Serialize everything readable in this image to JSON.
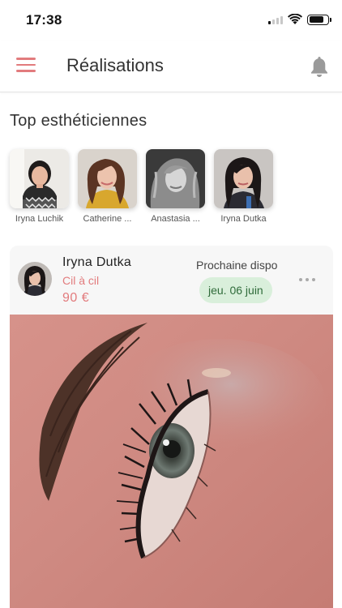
{
  "status_bar": {
    "time": "17:38"
  },
  "header": {
    "title": "Réalisations"
  },
  "top_section": {
    "title": "Top esthéticiennes",
    "estheticians": [
      {
        "name": "Iryna Luchik"
      },
      {
        "name": "Catherine ..."
      },
      {
        "name": "Anastasia ..."
      },
      {
        "name": "Iryna Dutka"
      }
    ]
  },
  "post": {
    "name": "Iryna Dutka",
    "service": "Cil à cil",
    "price": "90 €",
    "next_label": "Prochaine dispo",
    "next_date": "jeu. 06 juin"
  },
  "colors": {
    "accent": "#e27b7d",
    "badge_bg": "#d9efdb",
    "badge_text": "#2f6b3a"
  },
  "icons": [
    "menu-icon",
    "bell-icon",
    "more-icon",
    "wifi-icon",
    "battery-icon",
    "signal-icon"
  ]
}
